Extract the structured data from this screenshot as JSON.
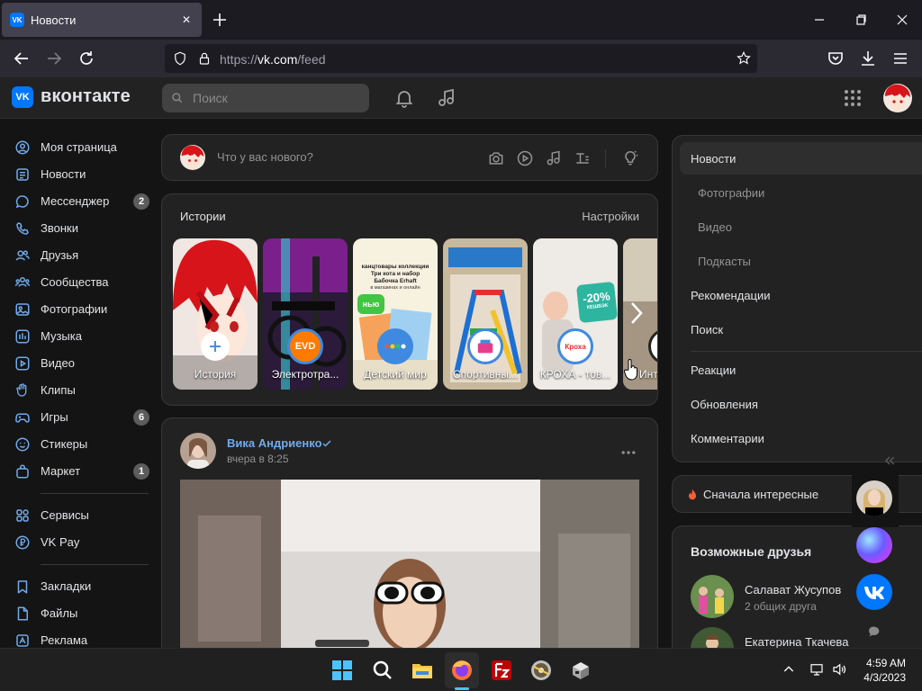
{
  "browser": {
    "tab_title": "Новости",
    "url_scheme": "https://",
    "url_host": "vk.com",
    "url_path": "/feed"
  },
  "header": {
    "logo_text": "вконтакте",
    "search_placeholder": "Поиск"
  },
  "sidebar": {
    "items": [
      {
        "label": "Моя страница",
        "icon": "user-circle-icon"
      },
      {
        "label": "Новости",
        "icon": "news-icon"
      },
      {
        "label": "Мессенджер",
        "icon": "message-icon",
        "badge": "2"
      },
      {
        "label": "Звонки",
        "icon": "phone-icon"
      },
      {
        "label": "Друзья",
        "icon": "friends-icon"
      },
      {
        "label": "Сообщества",
        "icon": "community-icon"
      },
      {
        "label": "Фотографии",
        "icon": "photo-icon"
      },
      {
        "label": "Музыка",
        "icon": "music-icon"
      },
      {
        "label": "Видео",
        "icon": "video-icon"
      },
      {
        "label": "Клипы",
        "icon": "clips-icon"
      },
      {
        "label": "Игры",
        "icon": "gamepad-icon",
        "badge": "6"
      },
      {
        "label": "Стикеры",
        "icon": "sticker-icon"
      },
      {
        "label": "Маркет",
        "icon": "market-icon",
        "badge": "1"
      },
      {
        "label": "Сервисы",
        "icon": "services-icon"
      },
      {
        "label": "VK Pay",
        "icon": "vkpay-icon"
      },
      {
        "label": "Закладки",
        "icon": "bookmark-icon"
      },
      {
        "label": "Файлы",
        "icon": "file-icon"
      },
      {
        "label": "Реклама",
        "icon": "ads-icon"
      }
    ]
  },
  "composer": {
    "placeholder": "Что у вас нового?"
  },
  "stories": {
    "title": "Истории",
    "settings": "Настройки",
    "items": [
      {
        "label": "История"
      },
      {
        "label": "Электротра..."
      },
      {
        "label": "Детский мир"
      },
      {
        "label": "Спортивны..."
      },
      {
        "label": "КРОХА - тов..."
      },
      {
        "label": "Инте"
      }
    ],
    "ad_text_1": "канцтовары коллекции Три кота и набор Бабочка Erhaft",
    "ad_text_2": "в магазинах и онлайн",
    "ad_badge": "нью",
    "discount": "-20%",
    "discount_sub": "КЕШБЭК",
    "kroha_logo": "Кроха"
  },
  "post": {
    "author": "Вика Андриенко",
    "time": "вчера в 8:25"
  },
  "right_nav": {
    "items": [
      {
        "label": "Новости",
        "sub": false
      },
      {
        "label": "Фотографии",
        "sub": true
      },
      {
        "label": "Видео",
        "sub": true
      },
      {
        "label": "Подкасты",
        "sub": true
      },
      {
        "label": "Рекомендации",
        "sub": false
      },
      {
        "label": "Поиск",
        "sub": false
      },
      {
        "label": "Реакции",
        "sub": false
      },
      {
        "label": "Обновления",
        "sub": false
      },
      {
        "label": "Комментарии",
        "sub": false
      }
    ]
  },
  "sort": {
    "label": "Сначала интересные"
  },
  "friends": {
    "title": "Возможные друзья",
    "items": [
      {
        "name": "Салават Жусупов",
        "mutual": "2 общих друга"
      },
      {
        "name": "Екатерина Ткачева",
        "mutual": ""
      }
    ]
  },
  "taskbar": {
    "time": "4:59 AM",
    "date": "4/3/2023"
  },
  "colors": {
    "accent": "#0077ff",
    "link": "#71aaeb",
    "background": "#141414",
    "card": "#222222"
  }
}
